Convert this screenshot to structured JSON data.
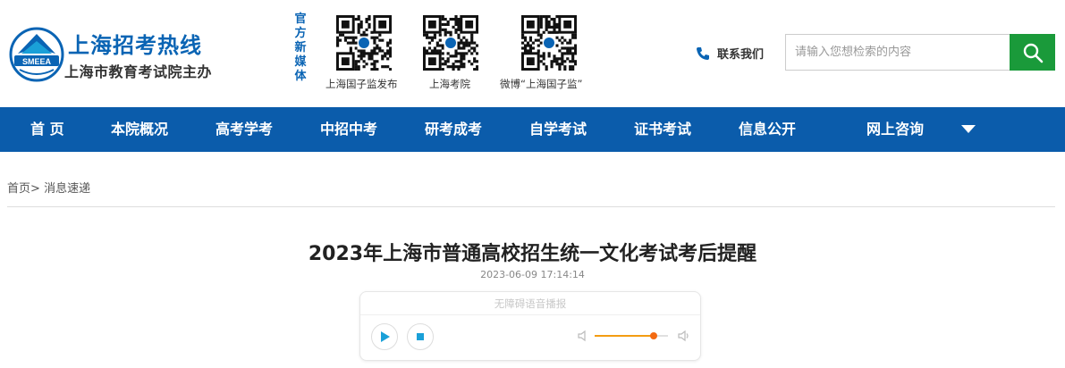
{
  "brand": {
    "title": "上海招考热线",
    "subtitle": "上海市教育考试院主办",
    "logo_text": "SMEEA"
  },
  "media": {
    "label": "官方新媒体",
    "qrcodes": [
      {
        "caption": "上海国子监发布",
        "icon": "qr-code-icon"
      },
      {
        "caption": "上海考院",
        "icon": "qr-code-icon"
      },
      {
        "caption": "微博“上海国子监”",
        "icon": "qr-code-icon"
      }
    ]
  },
  "contact": {
    "label": "联系我们",
    "icon": "phone-icon"
  },
  "search": {
    "placeholder": "请输入您想检索的内容",
    "icon": "search-icon"
  },
  "nav": {
    "items": [
      "首 页",
      "本院概况",
      "高考学考",
      "中招中考",
      "研考成考",
      "自学考试",
      "证书考试",
      "信息公开",
      "网上咨询"
    ],
    "caret_icon": "caret-down-icon"
  },
  "breadcrumb": {
    "home": "首页",
    "separator": ">",
    "current": "消息速递"
  },
  "article": {
    "title": "2023年上海市普通高校招生统一文化考试考后提醒",
    "date": "2023-06-09 17:14:14"
  },
  "player": {
    "header": "无障碍语音播报",
    "volume_level": 0.8
  },
  "colors": {
    "brand_blue": "#0a64b4",
    "nav_blue": "#0b5cab",
    "search_green": "#1a9a3a",
    "volume_orange": "#f36a12"
  }
}
